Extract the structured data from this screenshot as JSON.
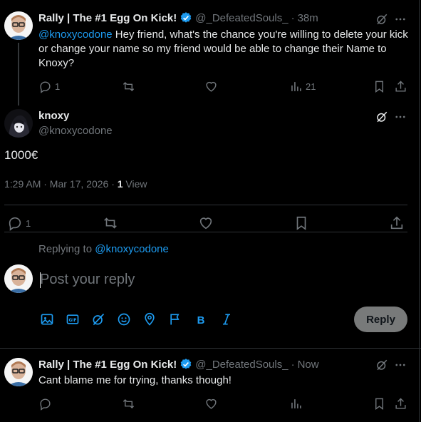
{
  "tweet1": {
    "display_name": "Rally | The #1 Egg On Kick!",
    "handle": "@_DefeatedSouls_",
    "time": "38m",
    "mention": "@knoxycodone",
    "text": " Hey friend, what's the chance you're willing to delete your kick or change your name so my friend would be able to change their Name to Knoxy?",
    "replies": "1",
    "views": "21"
  },
  "tweet2": {
    "display_name": "knoxy",
    "handle": "@knoxycodone",
    "text": "1000€",
    "timestamp": "1:29 AM · Mar 17, 2026 · ",
    "view_count": "1",
    "view_label": " View",
    "replies": "1"
  },
  "composer": {
    "replying_to_label": "Replying to ",
    "replying_to_handle": "@knoxycodone",
    "placeholder": "Post your reply",
    "reply_button": "Reply"
  },
  "tweet3": {
    "display_name": "Rally | The #1 Egg On Kick!",
    "handle": "@_DefeatedSouls_",
    "time": "Now",
    "text": "Cant blame me for trying, thanks though!"
  },
  "colors": {
    "accent": "#1d9bf0",
    "background": "#000000",
    "text": "#e7e9ea",
    "muted": "#71767b",
    "divider": "#2f3336",
    "verified": "#1d9bf0"
  }
}
